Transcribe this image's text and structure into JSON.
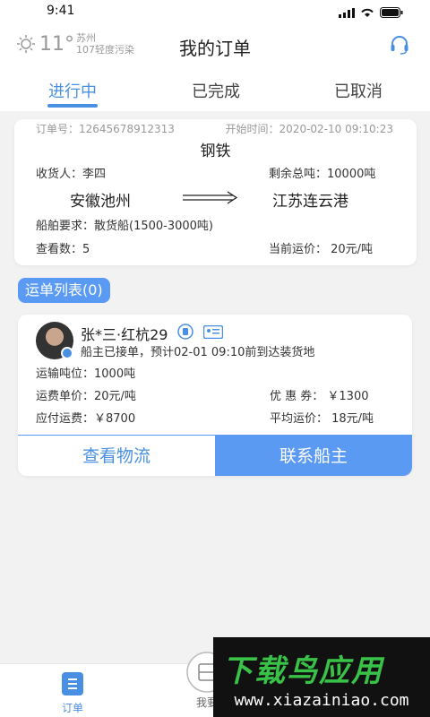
{
  "status_bar": {
    "time": "9:41"
  },
  "header": {
    "weather_temp": "11°",
    "weather_city": "苏州",
    "weather_aqi": "107轻度污染",
    "title": "我的订单"
  },
  "tabs": [
    {
      "label": "进行中"
    },
    {
      "label": "已完成"
    },
    {
      "label": "已取消"
    }
  ],
  "order": {
    "order_no": "订单号：12645678912313",
    "start_time": "开始时间：2020-02-10 09:10:23",
    "cargo": "钢铁",
    "consignee": "收货人：李四",
    "remaining": "剩余总吨：10000吨",
    "from": "安徽池州",
    "to": "江苏连云港",
    "ship_req": "船舶要求：散货船(1500-3000吨)",
    "view_count": "查看数：5",
    "current_price": "当前运价：  20元/吨"
  },
  "waybill": {
    "title": "运单列表(0)",
    "name": "张*三·红杭29",
    "status": "船主已接单，预计02-01 09:10前到达装货地",
    "tonnage": "运输吨位：1000吨",
    "unit_price": "运费单价：20元/吨",
    "coupon": "优 惠 券：  ￥1300",
    "payable": "应付运费：￥8700",
    "avg_price": "平均运价：  18元/吨",
    "btn_logistics": "查看物流",
    "btn_contact": "联系船主"
  },
  "bottom_nav": {
    "orders": "订单",
    "mine": "我要"
  },
  "watermark": {
    "title": "下载鸟应用",
    "url": "www.xiazainiao.com"
  },
  "colors": {
    "accent": "#4a90e2",
    "button": "#5b9af2",
    "watermark_green": "#39c148"
  }
}
